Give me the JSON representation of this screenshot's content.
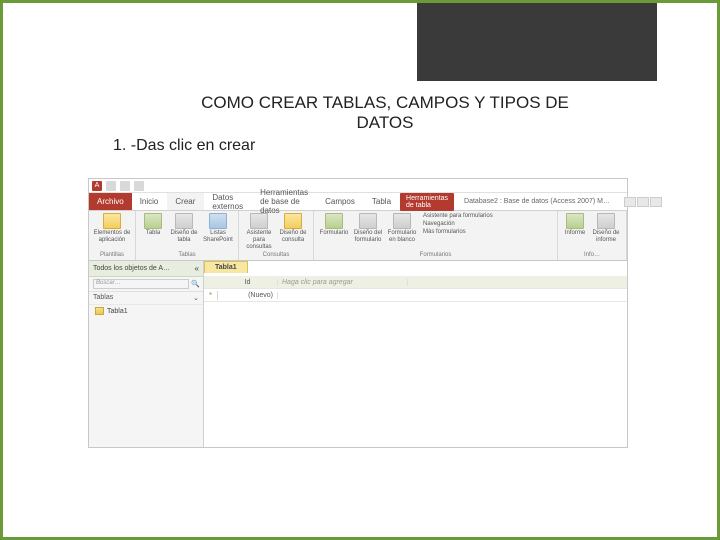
{
  "slide": {
    "title_l1": "COMO CREAR TABLAS, CAMPOS Y TIPOS DE",
    "title_l2": "DATOS",
    "step": "1. -Das clic en crear"
  },
  "qat": {
    "app_letter": "A"
  },
  "tabs": {
    "file": "Archivo",
    "items": [
      "Inicio",
      "Crear",
      "Datos externos",
      "Herramientas de base de datos",
      "Campos",
      "Tabla"
    ],
    "context_badge": "Herramientas de tabla",
    "db_title": "Database2 : Base de datos (Access 2007)   M…"
  },
  "ribbon": {
    "g1": {
      "col1": "Elementos de aplicación",
      "footer": "Plantillas"
    },
    "g2": {
      "c1": "Tabla",
      "c2": "Diseño de tabla",
      "c3": "Listas SharePoint",
      "footer": "Tablas"
    },
    "g3": {
      "c1": "Asistente para consultas",
      "c2": "Diseño de consulta",
      "footer": "Consultas"
    },
    "g4": {
      "c1": "Formulario",
      "c2": "Diseño del formulario",
      "c3": "Formulario en blanco",
      "side1": "Asistente para formularios",
      "side2": "Navegación",
      "side3": "Más formularios",
      "footer": "Formularios"
    },
    "g5": {
      "c1": "Informe",
      "c2": "Diseño de informe",
      "footer": "Info…"
    }
  },
  "nav": {
    "header": "Todos los objetos de A…",
    "search_placeholder": "Buscar…",
    "section": "Tablas",
    "item": "Tabla1"
  },
  "datasheet": {
    "tab": "Tabla1",
    "col_id": "Id",
    "col_add": "Haga clic para agregar",
    "new_row": "(Nuevo)",
    "star": "*"
  }
}
